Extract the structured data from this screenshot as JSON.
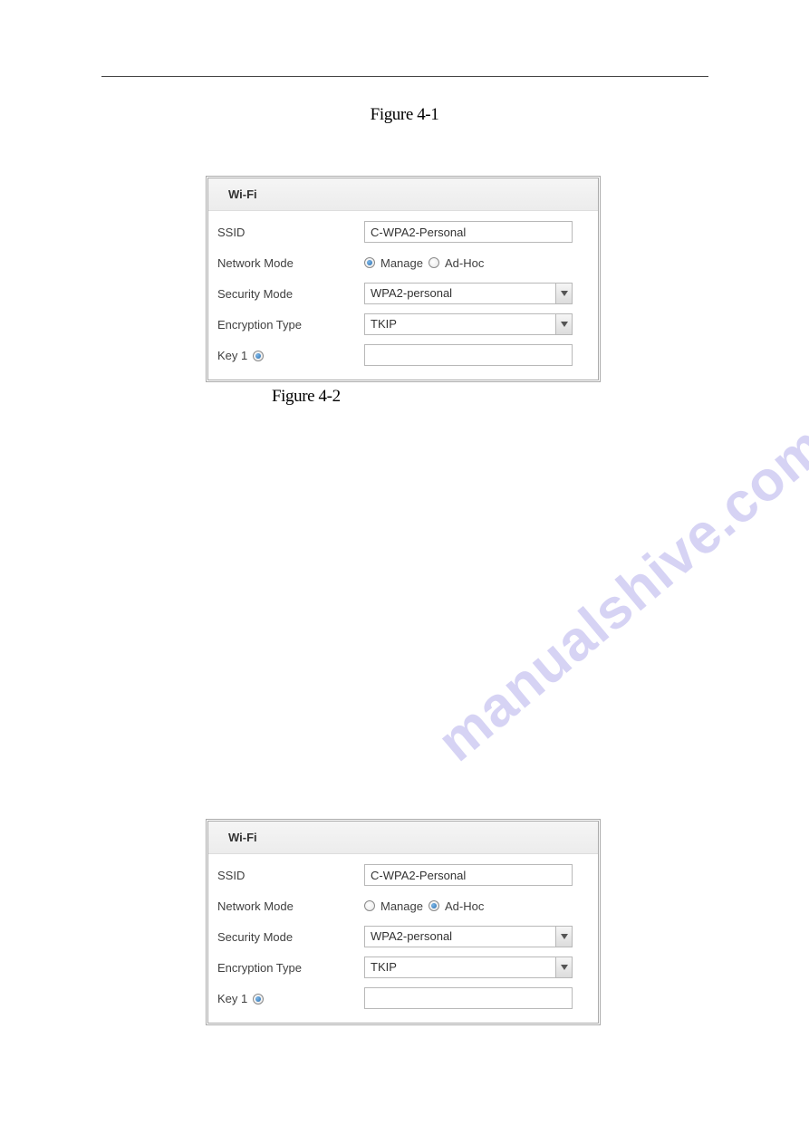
{
  "captions": {
    "fig41": "Figure 4-1",
    "fig42": "Figure 4-2"
  },
  "watermark_text": "manualshive.com",
  "panel1": {
    "title": "Wi-Fi",
    "ssid": {
      "label": "SSID",
      "value": "C-WPA2-Personal"
    },
    "network_mode": {
      "label": "Network Mode",
      "options": {
        "manage": "Manage",
        "adhoc": "Ad-Hoc"
      },
      "selected": "manage"
    },
    "security_mode": {
      "label": "Security Mode",
      "value": "WPA2-personal"
    },
    "encryption_type": {
      "label": "Encryption Type",
      "value": "TKIP"
    },
    "key1": {
      "label": "Key 1",
      "value": ""
    }
  },
  "panel2": {
    "title": "Wi-Fi",
    "ssid": {
      "label": "SSID",
      "value": "C-WPA2-Personal"
    },
    "network_mode": {
      "label": "Network Mode",
      "options": {
        "manage": "Manage",
        "adhoc": "Ad-Hoc"
      },
      "selected": "adhoc"
    },
    "security_mode": {
      "label": "Security Mode",
      "value": "WPA2-personal"
    },
    "encryption_type": {
      "label": "Encryption Type",
      "value": "TKIP"
    },
    "key1": {
      "label": "Key 1",
      "value": ""
    }
  }
}
